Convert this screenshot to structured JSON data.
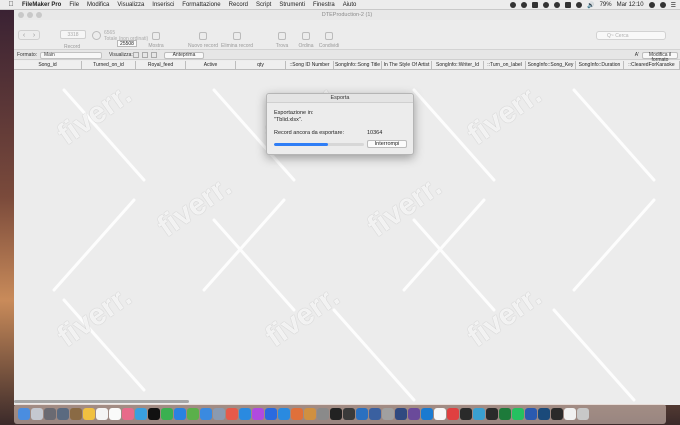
{
  "menubar": {
    "items": [
      "FileMaker Pro",
      "File",
      "Modifica",
      "Visualizza",
      "Inserisci",
      "Formattazione",
      "Record",
      "Script",
      "Strumenti",
      "Finestra",
      "Aiuto"
    ],
    "battery": "79%",
    "clock": "Mar 12:10"
  },
  "window": {
    "title": "DTEProduction-2 (1)",
    "toolbar": {
      "record_field": "3318",
      "found_count": "6565",
      "found_label": "Totale (non ordinati)",
      "tooltip": "25508",
      "labels": {
        "records": "Record",
        "show_all": "Mostra tutti",
        "new_record": "Nuovo record",
        "delete_record": "Elimina record",
        "find": "Trova",
        "sort": "Ordina",
        "share": "Condividi"
      },
      "search_placeholder": "Q~ Cerca"
    },
    "layoutbar": {
      "layout_label": "Formato:",
      "layout_value": "Main",
      "view_label": "Visualizza:",
      "preview_button": "Anteprima",
      "modify_button": "Modifica il formato"
    },
    "columns": [
      "Song_id",
      "Turned_on_id",
      "Royal_feed",
      "Active",
      "qty",
      "::Song ID Number",
      "SongInfo::Song Title",
      "In The Style Of Artist",
      "SongInfo::Writer_Id",
      "::Turn_on_label",
      "SongInfo::Song_Key",
      "SongInfo::Duration",
      "::ClearedForKaraoke"
    ]
  },
  "dialog": {
    "title": "Esporta",
    "line1": "Esportazione in:",
    "line2": "\"Tblid.xlsx\".",
    "remaining_label": "Record ancora da esportare:",
    "remaining_value": "10364",
    "progress": 0.6,
    "stop_button": "Interrompi"
  },
  "watermark": "fiverr.",
  "colors": {
    "accent": "#2f7ef6"
  }
}
